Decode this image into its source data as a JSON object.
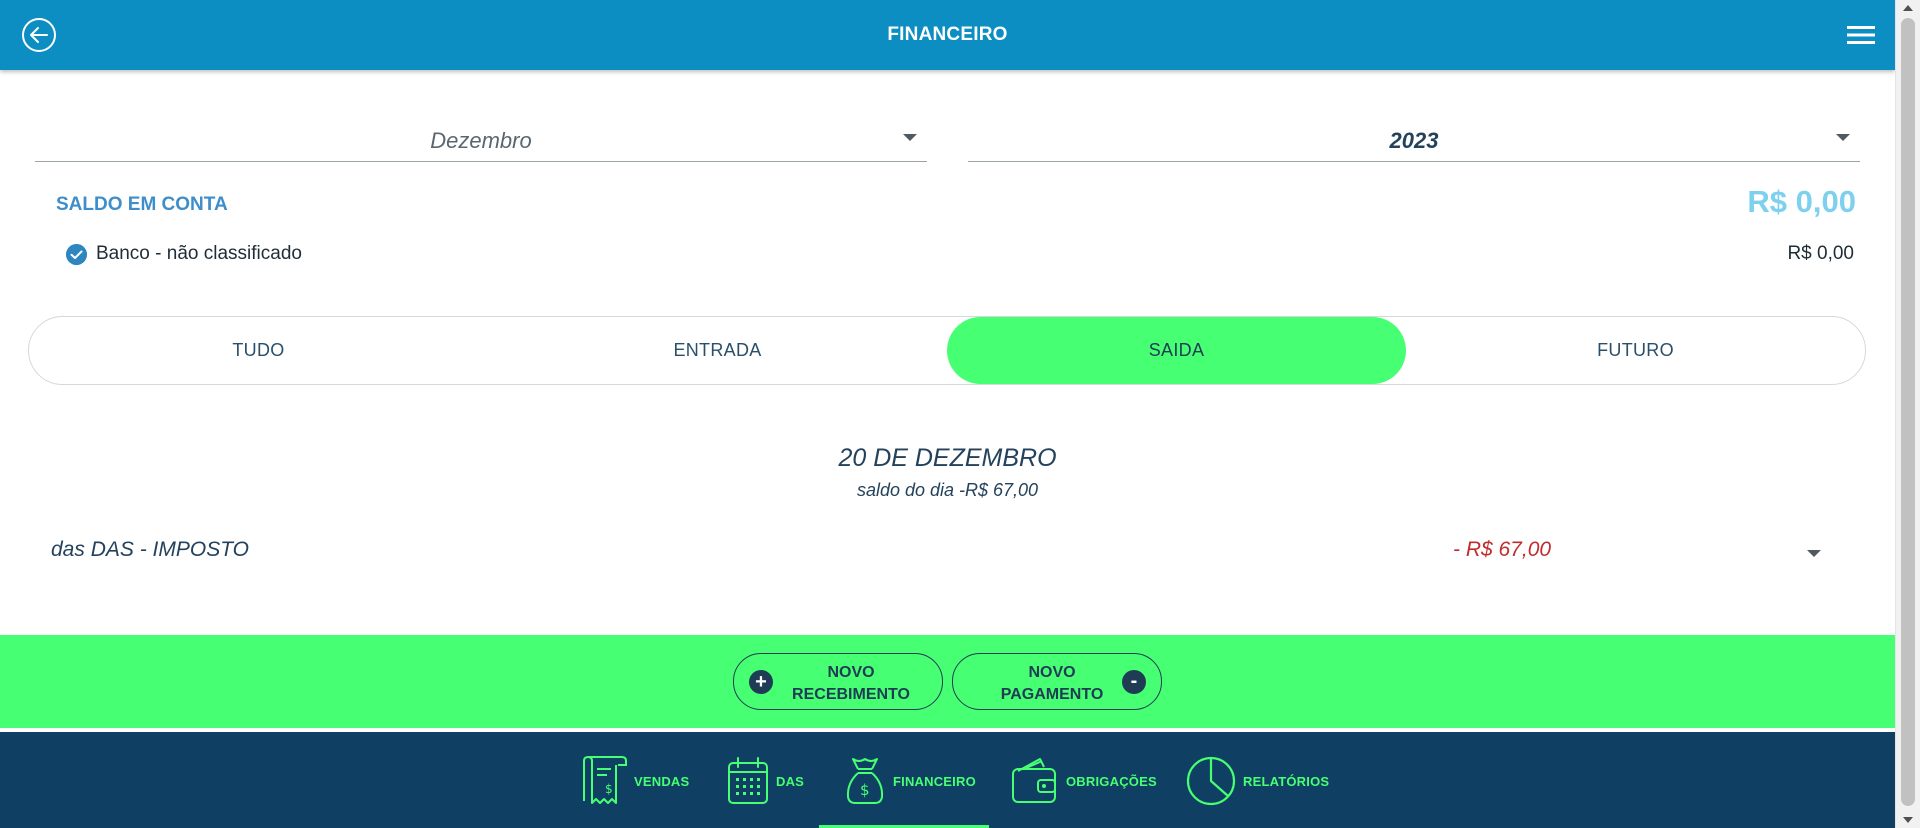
{
  "header": {
    "title": "FINANCEIRO"
  },
  "filters": {
    "month": "Dezembro",
    "year": "2023"
  },
  "saldo": {
    "label": "SALDO EM CONTA",
    "total": "R$ 0,00",
    "accounts": [
      {
        "name": "Banco - não classificado",
        "value": "R$ 0,00",
        "checked": true
      }
    ]
  },
  "tabs": [
    {
      "label": "TUDO",
      "active": false
    },
    {
      "label": "ENTRADA",
      "active": false
    },
    {
      "label": "SAIDA",
      "active": true
    },
    {
      "label": "FUTURO",
      "active": false
    }
  ],
  "day": {
    "title": "20 DE DEZEMBRO",
    "subtitle": "saldo do dia -R$ 67,00",
    "entries": [
      {
        "label": "das DAS - IMPOSTO",
        "value": "- R$ 67,00"
      }
    ]
  },
  "actions": {
    "receber_line1": "NOVO",
    "receber_line2": "RECEBIMENTO",
    "receber_icon": "+",
    "pagar_line1": "NOVO",
    "pagar_line2": "PAGAMENTO",
    "pagar_icon": "-"
  },
  "bottom_nav": {
    "vendas": "VENDAS",
    "das": "DAS",
    "financeiro": "FINANCEIRO",
    "obrigacoes": "OBRIGAÇÕES",
    "relatorios": "RELATÓRIOS",
    "active": "financeiro"
  },
  "colors": {
    "header": "#0c8ec2",
    "accent_green": "#46ff72",
    "nav_bg": "#0f4063",
    "negative": "#c12d2d"
  }
}
